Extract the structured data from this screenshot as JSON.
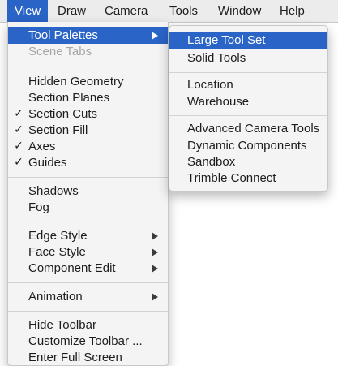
{
  "menubar": {
    "items": [
      "View",
      "Draw",
      "Camera",
      "Tools",
      "Window",
      "Help"
    ]
  },
  "view_menu": {
    "tool_palettes": "Tool Palettes",
    "scene_tabs": "Scene Tabs",
    "hidden_geometry": "Hidden Geometry",
    "section_planes": "Section Planes",
    "section_cuts": "Section Cuts",
    "section_fill": "Section Fill",
    "axes": "Axes",
    "guides": "Guides",
    "shadows": "Shadows",
    "fog": "Fog",
    "edge_style": "Edge Style",
    "face_style": "Face Style",
    "component_edit": "Component Edit",
    "animation": "Animation",
    "hide_toolbar": "Hide Toolbar",
    "customize_toolbar": "Customize Toolbar ...",
    "enter_full_screen": "Enter Full Screen",
    "checkmark": "✓"
  },
  "tool_palettes_submenu": {
    "large_tool_set": "Large Tool Set",
    "solid_tools": "Solid Tools",
    "location": "Location",
    "warehouse": "Warehouse",
    "advanced_camera_tools": "Advanced Camera Tools",
    "dynamic_components": "Dynamic Components",
    "sandbox": "Sandbox",
    "trimble_connect": "Trimble Connect"
  },
  "colors": {
    "highlight": "#2b64c7",
    "menu_bg": "#f4f4f4",
    "disabled_text": "#a6a6a6"
  },
  "icons": [
    "checkmark-icon",
    "submenu-arrow-icon"
  ]
}
